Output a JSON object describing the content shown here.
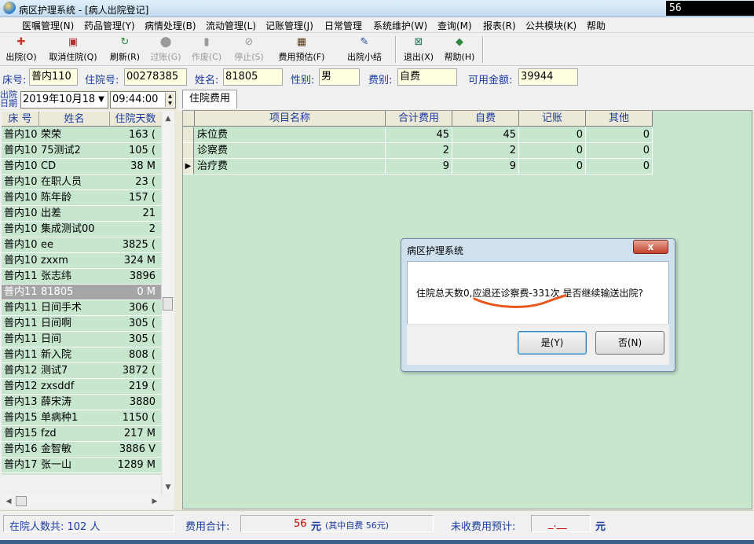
{
  "window": {
    "title": "病区护理系统 - [病人出院登记]",
    "corner_value": "56"
  },
  "menu": [
    "医嘱管理(N)",
    "药品管理(Y)",
    "病情处理(B)",
    "流动管理(L)",
    "记账管理(J)",
    "日常管理",
    "系统维护(W)",
    "查询(M)",
    "报表(R)",
    "公共模块(K)",
    "帮助"
  ],
  "toolbar": {
    "discharge": "出院(O)",
    "cancel_discharge": "取消住院(Q)",
    "refresh": "刷新(R)",
    "filter": "过账(G)",
    "void": "作废(C)",
    "stop": "停止(S)",
    "fee_estimate": "费用预估(F)",
    "discharge_summary": "出院小结",
    "exit": "退出(X)",
    "help": "帮助(H)"
  },
  "patient": {
    "bed_label": "床号:",
    "bed": "普内110",
    "admission_no_label": "住院号:",
    "admission_no": "00278385",
    "name_label": "姓名:",
    "name": "81805",
    "gender_label": "性别:",
    "gender": "男",
    "fee_type_label": "费别:",
    "fee_type": "自费",
    "available_label": "可用金额:",
    "available": "39944"
  },
  "discharge": {
    "date_label": "出院日期",
    "date": "2019年10月18",
    "time": "09:44:00"
  },
  "patient_list": {
    "headers": [
      "床 号",
      "姓名",
      "住院天数"
    ],
    "rows": [
      {
        "bed": "普内10",
        "name": "荣荣",
        "days": "163 ("
      },
      {
        "bed": "普内10",
        "name": "75测试2",
        "days": "105 ("
      },
      {
        "bed": "普内10",
        "name": "CD",
        "days": "38 M"
      },
      {
        "bed": "普内10",
        "name": "在职人员",
        "days": "23 ("
      },
      {
        "bed": "普内10",
        "name": "陈年龄",
        "days": "157 ("
      },
      {
        "bed": "普内10",
        "name": "出差",
        "days": "21"
      },
      {
        "bed": "普内10",
        "name": "集成测试00",
        "days": "2"
      },
      {
        "bed": "普内10",
        "name": "ee",
        "days": "3825 ("
      },
      {
        "bed": "普内10",
        "name": "zxxm",
        "days": "324 M"
      },
      {
        "bed": "普内11",
        "name": "张志纬",
        "days": "3896"
      },
      {
        "bed": "普内11",
        "name": "81805",
        "days": "0 M"
      },
      {
        "bed": "普内11",
        "name": "日间手术",
        "days": "306 ("
      },
      {
        "bed": "普内11",
        "name": "日间啊",
        "days": "305 ("
      },
      {
        "bed": "普内11",
        "name": "日间",
        "days": "305 ("
      },
      {
        "bed": "普内11",
        "name": "新入院",
        "days": "808 ("
      },
      {
        "bed": "普内12",
        "name": "测试7",
        "days": "3872 ("
      },
      {
        "bed": "普内12",
        "name": "zxsddf",
        "days": "219 ("
      },
      {
        "bed": "普内13",
        "name": "薛宋涛",
        "days": "3880"
      },
      {
        "bed": "普内15",
        "name": "单病种1",
        "days": "1150 ("
      },
      {
        "bed": "普内15",
        "name": "fzd",
        "days": "217 M"
      },
      {
        "bed": "普内16",
        "name": "金智敏",
        "days": "3886 V"
      },
      {
        "bed": "普内17",
        "name": "张一山",
        "days": "1289 M"
      }
    ]
  },
  "fee_tab": {
    "label": "住院费用"
  },
  "fee_table": {
    "headers": [
      "项目名称",
      "合计费用",
      "自费",
      "记账",
      "其他"
    ],
    "rows": [
      {
        "item": "床位费",
        "total": "45",
        "self": "45",
        "account": "0",
        "other": "0"
      },
      {
        "item": "诊察费",
        "total": "2",
        "self": "2",
        "account": "0",
        "other": "0"
      },
      {
        "item": "治疗费",
        "total": "9",
        "self": "9",
        "account": "0",
        "other": "0"
      }
    ]
  },
  "dialog": {
    "title": "病区护理系统",
    "message": "住院总天数0,应退还诊察费-331次,是否继续输送出院?",
    "yes": "是(Y)",
    "no": "否(N)",
    "close": "x"
  },
  "status": {
    "inpatients": "在院人数共: 102 人",
    "fee_total_label": "费用合计:",
    "fee_total_value": "56",
    "fee_unit": "元",
    "fee_self_note": "(其中自费 56元)",
    "unpaid_label": "未收费用预计:",
    "unpaid_value": "_.__",
    "unpaid_unit": "元"
  },
  "colors": {
    "accent_blue": "#1a3ca0",
    "grid_green": "#c7e6ce",
    "annotation_orange": "#e8571e"
  }
}
